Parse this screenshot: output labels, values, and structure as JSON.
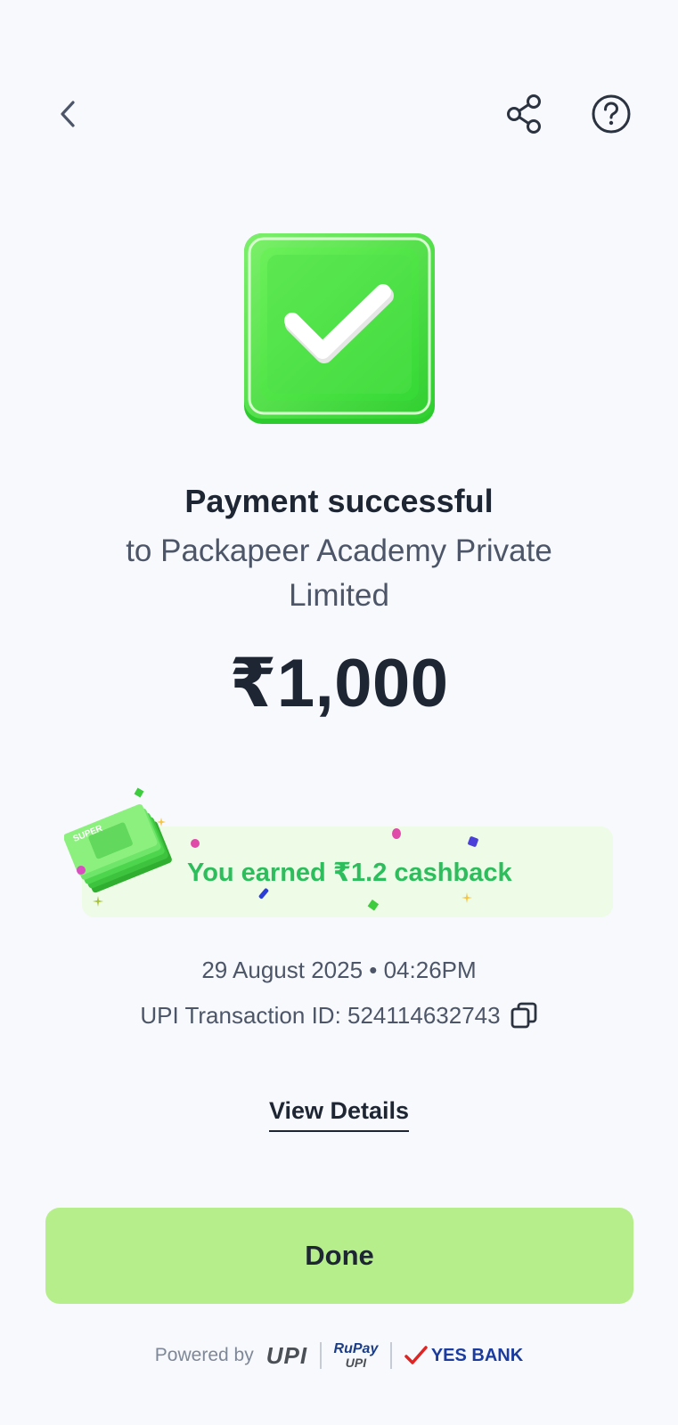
{
  "header": {
    "back_icon": "chevron-left-icon",
    "share_icon": "share-icon",
    "help_icon": "help-circle-icon"
  },
  "status": {
    "icon": "check-icon",
    "title": "Payment successful",
    "recipient": "to Packapeer Academy Private Limited",
    "amount": "₹1,000"
  },
  "cashback": {
    "text": "You earned ₹1.2 cashback",
    "badge": "SUPER"
  },
  "transaction": {
    "datetime": "29 August 2025 • 04:26PM",
    "upi_label": "UPI Transaction ID: 524114632743"
  },
  "actions": {
    "view_details": "View Details",
    "done": "Done"
  },
  "footer": {
    "powered_by": "Powered by",
    "upi_logo": "UPI",
    "rupay_logo": "RuPay",
    "rupay_sub": "UPI",
    "bank_logo": "YES BANK"
  },
  "colors": {
    "background": "#f7f9fc",
    "success_green": "#3ee03e",
    "cashback_text": "#2dbd5c",
    "cashback_bg": "#eefbe6",
    "done_button": "#b5ee8a",
    "text_primary": "#1e2533",
    "text_secondary": "#4d5668"
  }
}
